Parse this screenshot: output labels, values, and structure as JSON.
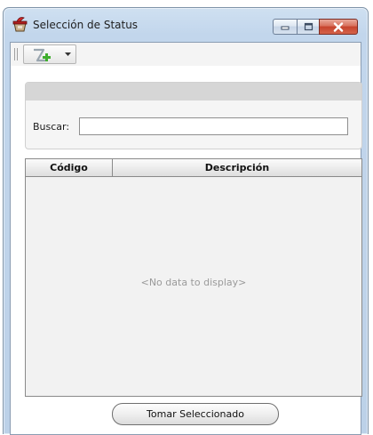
{
  "window": {
    "title": "Selección de Status",
    "icon": "app-cup-icon"
  },
  "titlebar": {
    "minimize_icon": "minimize-icon",
    "maximize_icon": "maximize-icon",
    "close_icon": "close-icon"
  },
  "toolbar": {
    "dropdown_icon": "add-filter-icon"
  },
  "search": {
    "label": "Buscar:",
    "value": "",
    "placeholder": ""
  },
  "grid": {
    "columns": [
      "Código",
      "Descripción"
    ],
    "rows": [],
    "empty_text": "<No data to display>"
  },
  "actions": {
    "take_selected_label": "Tomar Seleccionado"
  },
  "colors": {
    "titlebar": "#c2d6ec",
    "close_button": "#c6432c",
    "grid_background": "#f2f2f2"
  }
}
